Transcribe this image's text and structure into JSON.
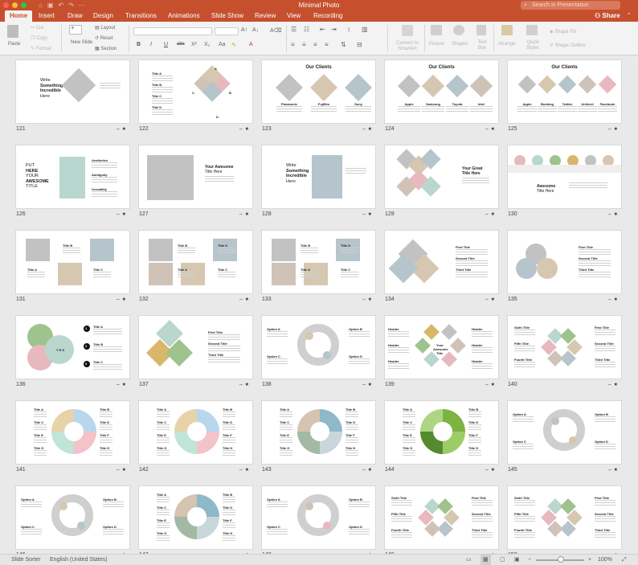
{
  "window": {
    "title": "Minimal Photo",
    "search_placeholder": "Search in Presentation",
    "share": "Share"
  },
  "tabs": [
    "Home",
    "Insert",
    "Draw",
    "Design",
    "Transitions",
    "Animations",
    "Slide Show",
    "Review",
    "View",
    "Recording"
  ],
  "ribbon": {
    "paste": "Paste",
    "cut": "Cut",
    "copy": "Copy",
    "format": "Format",
    "new_slide": "New Slide",
    "layout": "Layout",
    "reset": "Reset",
    "section": "Section",
    "convert": "Convert to SmartArt",
    "picture": "Picture",
    "shapes": "Shapes",
    "text_box": "Text Box",
    "arrange": "Arrange",
    "quick_styles": "Quick Styles",
    "shape_fill": "Shape Fill",
    "shape_outline": "Shape Outline",
    "bold": "B",
    "italic": "I",
    "underline": "U",
    "strike": "abc"
  },
  "slides": [
    {
      "n": "121",
      "titles": [
        "Write",
        "Something",
        "Incredible",
        "Here"
      ]
    },
    {
      "n": "122",
      "titles": [
        "Title A",
        "Title B",
        "Title C",
        "Title D",
        "A",
        "B",
        "C",
        "D"
      ]
    },
    {
      "n": "123",
      "titles": [
        "Our Clients",
        "Panasonic",
        "Fujifilm",
        "Sony"
      ]
    },
    {
      "n": "124",
      "titles": [
        "Our Clients",
        "Apple",
        "Samsung",
        "Toyota",
        "Intel"
      ]
    },
    {
      "n": "125",
      "titles": [
        "Our Clients",
        "Apple",
        "Booking",
        "Twitter",
        "Unilevel",
        "Facebook"
      ]
    },
    {
      "n": "126",
      "titles": [
        "PUT",
        "HERE",
        "YOUR",
        "AWESOME",
        "TITLE",
        "Aesthetics",
        "Ambiguity",
        "Versatility"
      ]
    },
    {
      "n": "127",
      "titles": [
        "Your Awesome",
        "Title Here"
      ]
    },
    {
      "n": "128",
      "titles": [
        "Write",
        "Something",
        "Incredible",
        "Here"
      ]
    },
    {
      "n": "129",
      "titles": [
        "Your Great",
        "Title Here"
      ]
    },
    {
      "n": "130",
      "titles": [
        "Awesome",
        "Title Here"
      ]
    },
    {
      "n": "131",
      "titles": [
        "Title B",
        "Title A",
        "Title C"
      ]
    },
    {
      "n": "132",
      "titles": [
        "Title B",
        "Title D",
        "Title A",
        "Title C"
      ]
    },
    {
      "n": "133",
      "titles": [
        "Title B",
        "Title D",
        "Title A",
        "Title C"
      ]
    },
    {
      "n": "134",
      "titles": [
        "First Title",
        "Second Title",
        "Third Title"
      ]
    },
    {
      "n": "135",
      "titles": [
        "First Title",
        "Second Title",
        "Third Title"
      ]
    },
    {
      "n": "136",
      "titles": [
        "1",
        "2",
        "3",
        "Title A",
        "Title B",
        "Title C",
        "Y E S"
      ]
    },
    {
      "n": "137",
      "titles": [
        "First Title",
        "Second Title",
        "Third Title"
      ]
    },
    {
      "n": "138",
      "titles": [
        "Option A",
        "Option B",
        "Option C",
        "Option D"
      ]
    },
    {
      "n": "139",
      "titles": [
        "Your",
        "Awesome",
        "Title",
        "Header",
        "Header",
        "Header",
        "Header",
        "Header",
        "Header"
      ]
    },
    {
      "n": "140",
      "titles": [
        "Sixth Title",
        "First Title",
        "Fifth Title",
        "Second Title",
        "Fourth Title",
        "Third Title"
      ]
    },
    {
      "n": "141",
      "titles": [
        "Title A",
        "Title B",
        "Title C",
        "Title D",
        "Title E",
        "Title F",
        "Title G",
        "Title H"
      ]
    },
    {
      "n": "142",
      "titles": [
        "Title A",
        "Title B",
        "Title C",
        "Title D",
        "Title E",
        "Title F",
        "Title G",
        "Title H"
      ]
    },
    {
      "n": "143",
      "titles": [
        "Title A",
        "Title B",
        "Title C",
        "Title D",
        "Title E",
        "Title F",
        "Title G",
        "Title H"
      ]
    },
    {
      "n": "144",
      "titles": [
        "Title A",
        "Title B",
        "Title C",
        "Title D",
        "Title E",
        "Title F",
        "Title G",
        "Title H"
      ]
    },
    {
      "n": "145",
      "titles": [
        "Option A",
        "Option B",
        "Option C",
        "Option D"
      ]
    },
    {
      "n": "146",
      "titles": [
        "Option A",
        "Option B",
        "Option C",
        "Option D"
      ]
    },
    {
      "n": "147",
      "titles": [
        "Title A",
        "Title B",
        "Title C",
        "Title D",
        "Title E",
        "Title F",
        "Title G",
        "Title H"
      ]
    },
    {
      "n": "148",
      "titles": [
        "Option A",
        "Option B",
        "Option C",
        "Option D"
      ]
    },
    {
      "n": "149",
      "titles": [
        "Sixth Title",
        "First Title",
        "Fifth Title",
        "Second Title",
        "Fourth Title",
        "Third Title"
      ]
    },
    {
      "n": "150",
      "titles": [
        "Sixth Title",
        "First Title",
        "Fifth Title",
        "Second Title",
        "Fourth Title",
        "Third Title"
      ]
    }
  ],
  "status": {
    "view": "Slide Sorter",
    "language": "English (United States)",
    "zoom": "100%"
  },
  "colors": {
    "accent": "#c6502e",
    "pink": "#f2c3c9",
    "blue": "#b8d7ec",
    "mint": "#bfe4d8",
    "green": "#7cb342"
  }
}
